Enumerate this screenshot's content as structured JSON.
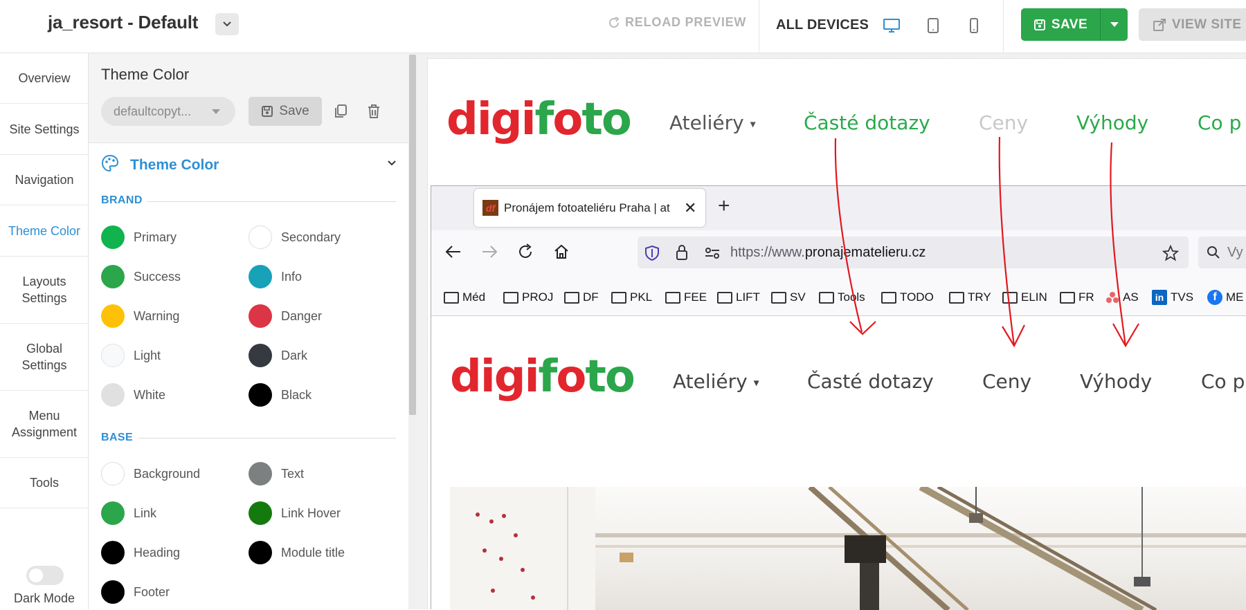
{
  "header": {
    "app_title": "ja_resort - Default",
    "reload_label": "RELOAD PREVIEW",
    "devices_label": "ALL DEVICES",
    "save_label": "SAVE",
    "view_label": "VIEW SITE"
  },
  "nav": {
    "items": [
      {
        "label": "Overview"
      },
      {
        "label": "Site Settings"
      },
      {
        "label": "Navigation"
      },
      {
        "label": "Theme Color"
      },
      {
        "label": "Layouts Settings"
      },
      {
        "label": "Global Settings"
      },
      {
        "label": "Menu Assignment"
      },
      {
        "label": "Tools"
      }
    ],
    "dark_mode_label": "Dark Mode",
    "active": "Theme Color"
  },
  "panel": {
    "title": "Theme Color",
    "preset_value": "defaultcopyt...",
    "save_label": "Save",
    "section_title": "Theme Color",
    "brand_label": "BRAND",
    "base_label": "BASE",
    "brand": [
      {
        "name": "Primary",
        "color": "#11b34f"
      },
      {
        "name": "Secondary",
        "color": "#ffffff"
      },
      {
        "name": "Success",
        "color": "#2ba64b"
      },
      {
        "name": "Info",
        "color": "#17a2b8"
      },
      {
        "name": "Warning",
        "color": "#ffc107"
      },
      {
        "name": "Danger",
        "color": "#dc3545"
      },
      {
        "name": "Light",
        "color": "#f8f9fa"
      },
      {
        "name": "Dark",
        "color": "#343a40"
      },
      {
        "name": "White",
        "color": "#e0e0e0"
      },
      {
        "name": "Black",
        "color": "#000000"
      }
    ],
    "base": [
      {
        "name": "Background",
        "color": "#ffffff"
      },
      {
        "name": "Text",
        "color": "#7c8080"
      },
      {
        "name": "Link",
        "color": "#2ba64b"
      },
      {
        "name": "Link Hover",
        "color": "#157a0d"
      },
      {
        "name": "Heading",
        "color": "#000000"
      },
      {
        "name": "Module title",
        "color": "#000000"
      },
      {
        "name": "Footer",
        "color": "#000000"
      }
    ]
  },
  "preview": {
    "logo_red": "digi",
    "logo_green_f": "f",
    "logo_red_o": "o",
    "logo_green_to": "to",
    "menu": [
      "Ateliéry",
      "Časté dotazy",
      "Ceny",
      "Výhody",
      "Co p"
    ]
  },
  "screenshot": {
    "tab_title": "Pronájem fotoateliéru Praha | at",
    "favicon": "df",
    "url_prefix": "https://www.",
    "url_domain": "pronajematelieru.cz",
    "search_placeholder": "Vy",
    "bookmarks": [
      "Méd",
      "PROJ",
      "DF",
      "PKL",
      "FEE",
      "LIFT",
      "SV",
      "Tools",
      "TODO",
      "TRY",
      "ELIN",
      "FR",
      "AS",
      "TVS",
      "ME"
    ],
    "menu": [
      "Ateliéry",
      "Časté dotazy",
      "Ceny",
      "Výhody",
      "Co p"
    ]
  },
  "colors": {
    "accent_blue": "#2d8fd5",
    "save_green": "#2ba64b",
    "menu_green": "#2aaa4a",
    "muted_gray": "#c8c8c8",
    "arrow_red": "#e3171d"
  }
}
